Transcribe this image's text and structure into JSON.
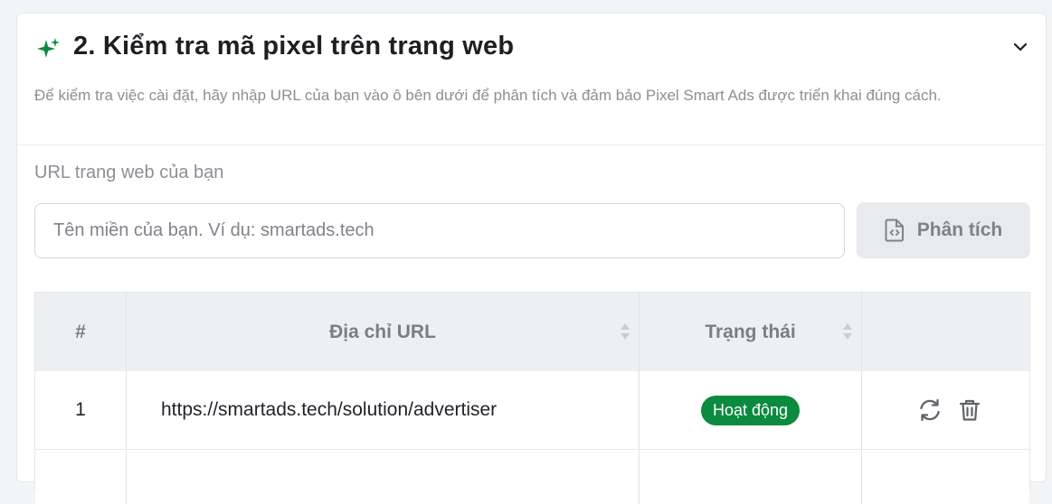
{
  "section": {
    "title": "2. Kiểm tra mã pixel trên trang web",
    "description": "Để kiểm tra việc cài đặt, hãy nhập URL của bạn vào ô bên dưới để phân tích và đảm bảo Pixel Smart Ads được triển khai đúng cách.",
    "accent_color": "#0c8a3e"
  },
  "form": {
    "url_label": "URL trang web của bạn",
    "url_placeholder": "Tên miền của bạn. Ví dụ: smartads.tech",
    "url_value": "",
    "analyze_label": "Phân tích"
  },
  "table": {
    "headers": [
      "#",
      "Địa chỉ URL",
      "Trạng thái",
      ""
    ],
    "rows": [
      {
        "index": "1",
        "url": "https://smartads.tech/solution/advertiser",
        "status": "Hoạt động"
      }
    ]
  },
  "icons": {
    "section": "sparkle-icon",
    "collapse": "chevron-down-icon",
    "analyze": "file-code-icon",
    "refresh": "refresh-icon",
    "delete": "trash-icon"
  }
}
